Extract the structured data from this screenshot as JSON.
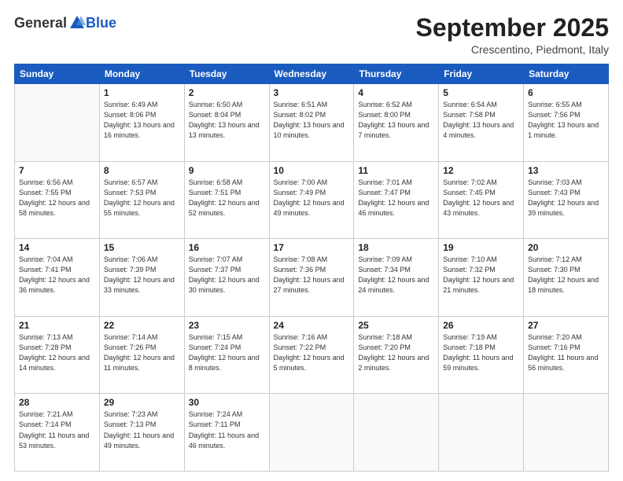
{
  "header": {
    "logo_general": "General",
    "logo_blue": "Blue",
    "title": "September 2025",
    "location": "Crescentino, Piedmont, Italy"
  },
  "days_of_week": [
    "Sunday",
    "Monday",
    "Tuesday",
    "Wednesday",
    "Thursday",
    "Friday",
    "Saturday"
  ],
  "weeks": [
    [
      {
        "day": "",
        "info": ""
      },
      {
        "day": "1",
        "info": "Sunrise: 6:49 AM\nSunset: 8:06 PM\nDaylight: 13 hours\nand 16 minutes."
      },
      {
        "day": "2",
        "info": "Sunrise: 6:50 AM\nSunset: 8:04 PM\nDaylight: 13 hours\nand 13 minutes."
      },
      {
        "day": "3",
        "info": "Sunrise: 6:51 AM\nSunset: 8:02 PM\nDaylight: 13 hours\nand 10 minutes."
      },
      {
        "day": "4",
        "info": "Sunrise: 6:52 AM\nSunset: 8:00 PM\nDaylight: 13 hours\nand 7 minutes."
      },
      {
        "day": "5",
        "info": "Sunrise: 6:54 AM\nSunset: 7:58 PM\nDaylight: 13 hours\nand 4 minutes."
      },
      {
        "day": "6",
        "info": "Sunrise: 6:55 AM\nSunset: 7:56 PM\nDaylight: 13 hours\nand 1 minute."
      }
    ],
    [
      {
        "day": "7",
        "info": "Sunrise: 6:56 AM\nSunset: 7:55 PM\nDaylight: 12 hours\nand 58 minutes."
      },
      {
        "day": "8",
        "info": "Sunrise: 6:57 AM\nSunset: 7:53 PM\nDaylight: 12 hours\nand 55 minutes."
      },
      {
        "day": "9",
        "info": "Sunrise: 6:58 AM\nSunset: 7:51 PM\nDaylight: 12 hours\nand 52 minutes."
      },
      {
        "day": "10",
        "info": "Sunrise: 7:00 AM\nSunset: 7:49 PM\nDaylight: 12 hours\nand 49 minutes."
      },
      {
        "day": "11",
        "info": "Sunrise: 7:01 AM\nSunset: 7:47 PM\nDaylight: 12 hours\nand 46 minutes."
      },
      {
        "day": "12",
        "info": "Sunrise: 7:02 AM\nSunset: 7:45 PM\nDaylight: 12 hours\nand 43 minutes."
      },
      {
        "day": "13",
        "info": "Sunrise: 7:03 AM\nSunset: 7:43 PM\nDaylight: 12 hours\nand 39 minutes."
      }
    ],
    [
      {
        "day": "14",
        "info": "Sunrise: 7:04 AM\nSunset: 7:41 PM\nDaylight: 12 hours\nand 36 minutes."
      },
      {
        "day": "15",
        "info": "Sunrise: 7:06 AM\nSunset: 7:39 PM\nDaylight: 12 hours\nand 33 minutes."
      },
      {
        "day": "16",
        "info": "Sunrise: 7:07 AM\nSunset: 7:37 PM\nDaylight: 12 hours\nand 30 minutes."
      },
      {
        "day": "17",
        "info": "Sunrise: 7:08 AM\nSunset: 7:36 PM\nDaylight: 12 hours\nand 27 minutes."
      },
      {
        "day": "18",
        "info": "Sunrise: 7:09 AM\nSunset: 7:34 PM\nDaylight: 12 hours\nand 24 minutes."
      },
      {
        "day": "19",
        "info": "Sunrise: 7:10 AM\nSunset: 7:32 PM\nDaylight: 12 hours\nand 21 minutes."
      },
      {
        "day": "20",
        "info": "Sunrise: 7:12 AM\nSunset: 7:30 PM\nDaylight: 12 hours\nand 18 minutes."
      }
    ],
    [
      {
        "day": "21",
        "info": "Sunrise: 7:13 AM\nSunset: 7:28 PM\nDaylight: 12 hours\nand 14 minutes."
      },
      {
        "day": "22",
        "info": "Sunrise: 7:14 AM\nSunset: 7:26 PM\nDaylight: 12 hours\nand 11 minutes."
      },
      {
        "day": "23",
        "info": "Sunrise: 7:15 AM\nSunset: 7:24 PM\nDaylight: 12 hours\nand 8 minutes."
      },
      {
        "day": "24",
        "info": "Sunrise: 7:16 AM\nSunset: 7:22 PM\nDaylight: 12 hours\nand 5 minutes."
      },
      {
        "day": "25",
        "info": "Sunrise: 7:18 AM\nSunset: 7:20 PM\nDaylight: 12 hours\nand 2 minutes."
      },
      {
        "day": "26",
        "info": "Sunrise: 7:19 AM\nSunset: 7:18 PM\nDaylight: 11 hours\nand 59 minutes."
      },
      {
        "day": "27",
        "info": "Sunrise: 7:20 AM\nSunset: 7:16 PM\nDaylight: 11 hours\nand 56 minutes."
      }
    ],
    [
      {
        "day": "28",
        "info": "Sunrise: 7:21 AM\nSunset: 7:14 PM\nDaylight: 11 hours\nand 53 minutes."
      },
      {
        "day": "29",
        "info": "Sunrise: 7:23 AM\nSunset: 7:13 PM\nDaylight: 11 hours\nand 49 minutes."
      },
      {
        "day": "30",
        "info": "Sunrise: 7:24 AM\nSunset: 7:11 PM\nDaylight: 11 hours\nand 46 minutes."
      },
      {
        "day": "",
        "info": ""
      },
      {
        "day": "",
        "info": ""
      },
      {
        "day": "",
        "info": ""
      },
      {
        "day": "",
        "info": ""
      }
    ]
  ]
}
